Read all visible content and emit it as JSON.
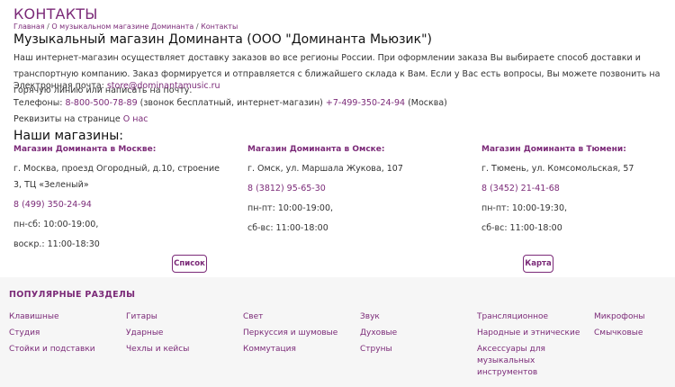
{
  "page_title": "КОНТАКТЫ",
  "breadcrumb": {
    "home": "Главная",
    "sep1": " / ",
    "about": "О музыкальном магазине Доминанта",
    "sep2": " / ",
    "current": "Контакты"
  },
  "heading": "Музыкальный магазин Доминанта (ООО \"Доминанта Мьюзик\")",
  "intro": "Наш интернет-магазин осуществляет доставку заказов во все регионы России. При оформлении заказа Вы выбираете способ доставки и транспортную компанию. Заказ формируется и отправляется с ближайшего склада к Вам. Если у Вас есть вопросы, Вы можете позвонить на горячую линию или написать на почту.",
  "email": {
    "label": "Электронная почта: ",
    "value": "store@dominantamusic.ru"
  },
  "phones": {
    "label": "Телефоны: ",
    "free": "8-800-500-78-89",
    "free_note": " (звонок бесплатный, интернет-магазин) ",
    "moscow": "+7-499-350-24-94",
    "moscow_note": " (Москва)"
  },
  "requisites": {
    "label": "Реквизиты на странице ",
    "link": "О нас"
  },
  "stores_heading": "Наши магазины:",
  "stores": [
    {
      "name": "Магазин Доминанта в Москве:",
      "address": "г. Москва, проезд Огородный, д.10, строение 3, ТЦ «Зеленый»",
      "phone": "8 (499) 350-24-94",
      "hours1": "пн-сб: 10:00-19:00,",
      "hours2": "воскр.: 11:00-18:30"
    },
    {
      "name": "Магазин Доминанта в Омске:",
      "address": "г. Омск, ул. Маршала Жукова, 107",
      "phone": "8 (3812) 95-65-30",
      "hours1": "пн-пт: 10:00-19:00,",
      "hours2": "сб-вс: 11:00-18:00"
    },
    {
      "name": "Магазин Доминанта в Тюмени:",
      "address": "г. Тюмень, ул. Комсомольская, 57",
      "phone": "8 (3452) 21-41-68",
      "hours1": "пн-пт: 10:00-19:30,",
      "hours2": "сб-вс: 11:00-18:00"
    }
  ],
  "buttons": {
    "list": "Список",
    "map": "Карта"
  },
  "footer": {
    "title": "ПОПУЛЯРНЫЕ РАЗДЕЛЫ",
    "columns": [
      [
        "Клавишные",
        "Студия",
        "Стойки и подставки"
      ],
      [
        "Гитары",
        "Ударные",
        "Чехлы и кейсы"
      ],
      [
        "Свет",
        "Перкуссия и шумовые",
        "Коммутация"
      ],
      [
        "Звук",
        "Духовые",
        "Струны"
      ],
      [
        "Трансляционное",
        "Народные и этнические",
        "Аксессуары для музыкальных инструментов"
      ],
      [
        "Микрофоны",
        "Смычковые"
      ]
    ]
  },
  "colors": {
    "accent": "#7b2a78",
    "footer_bg": "#f6f6f6"
  }
}
